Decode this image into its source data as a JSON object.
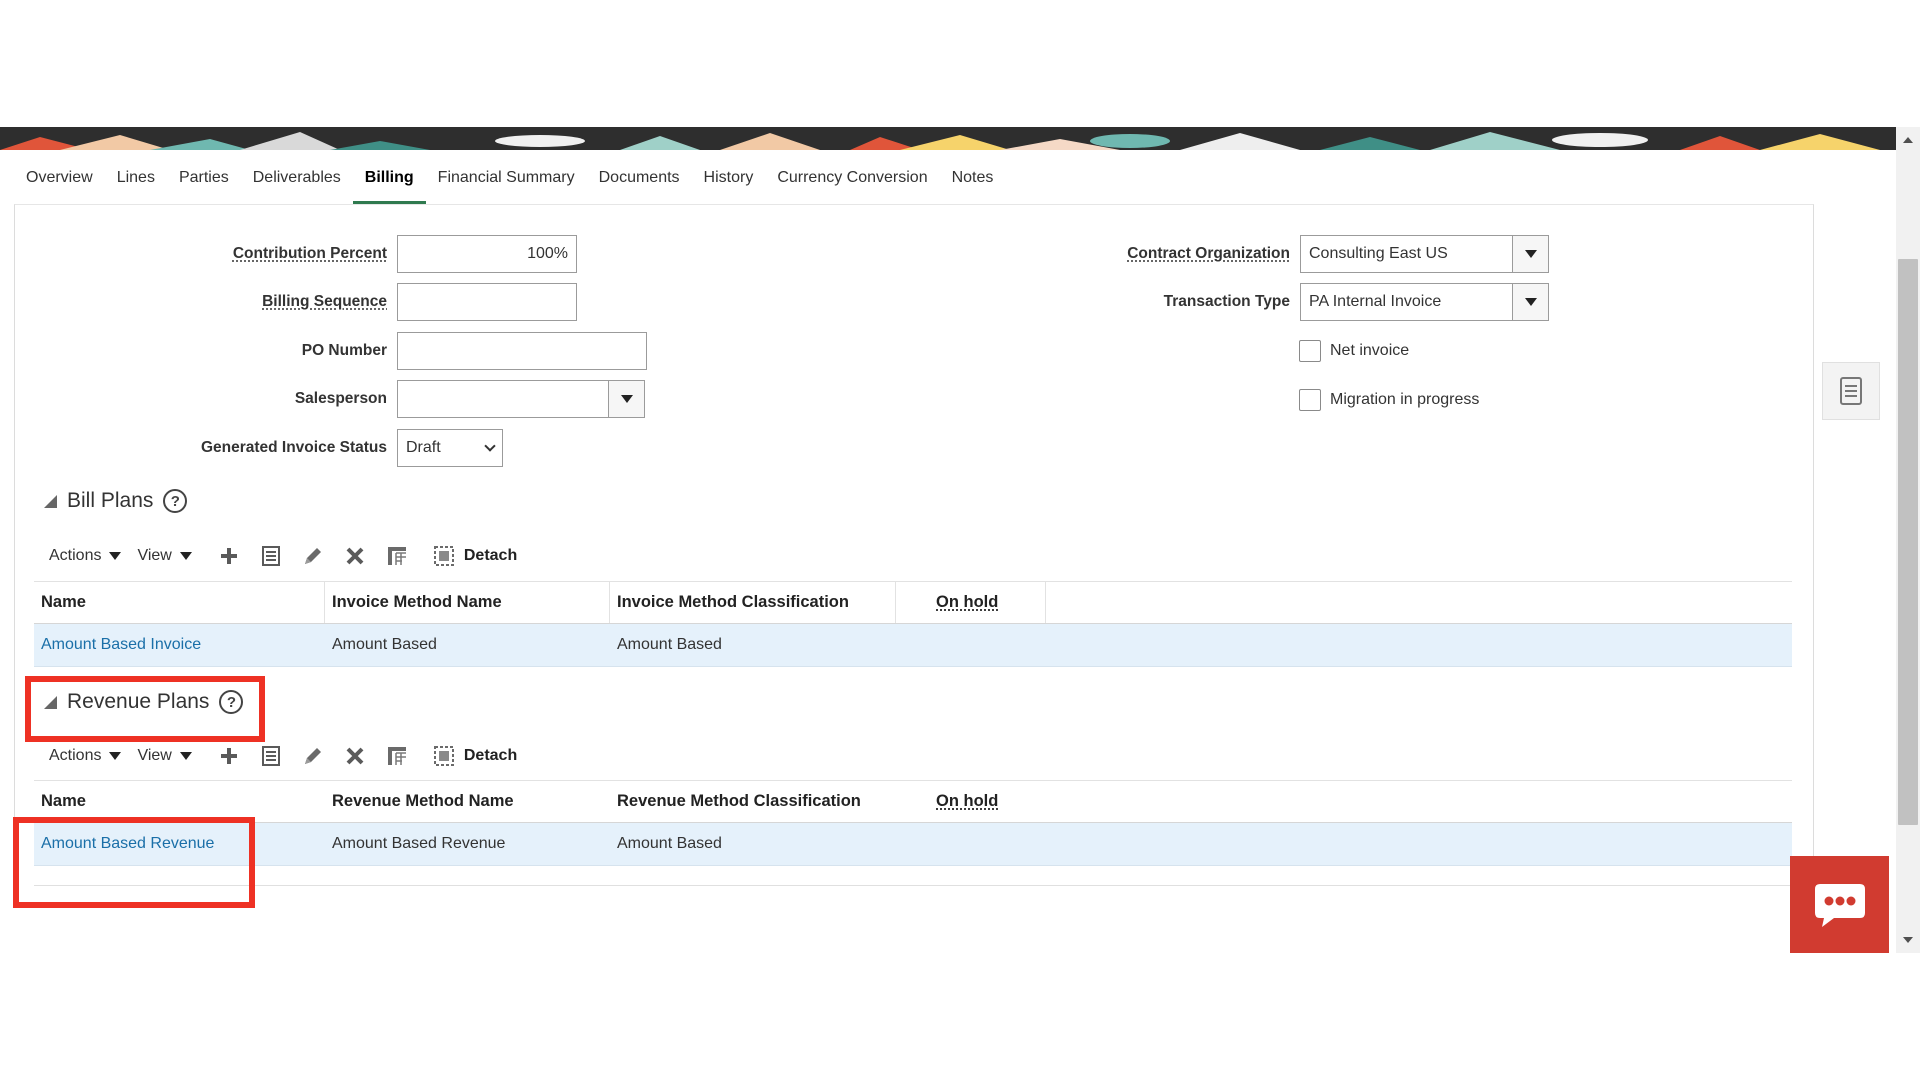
{
  "tabs": [
    "Overview",
    "Lines",
    "Parties",
    "Deliverables",
    "Billing",
    "Financial Summary",
    "Documents",
    "History",
    "Currency Conversion",
    "Notes"
  ],
  "active_tab": "Billing",
  "form": {
    "contribution_percent": {
      "label": "Contribution Percent",
      "value": "100%"
    },
    "billing_sequence": {
      "label": "Billing Sequence",
      "value": ""
    },
    "po_number": {
      "label": "PO Number",
      "value": ""
    },
    "salesperson": {
      "label": "Salesperson",
      "value": ""
    },
    "generated_invoice_status": {
      "label": "Generated Invoice Status",
      "value": "Draft"
    },
    "contract_organization": {
      "label": "Contract Organization",
      "value": "Consulting East US"
    },
    "transaction_type": {
      "label": "Transaction Type",
      "value": "PA Internal Invoice"
    },
    "net_invoice": {
      "label": "Net invoice",
      "checked": false
    },
    "migration_in_progress": {
      "label": "Migration in progress",
      "checked": false
    }
  },
  "bill_plans": {
    "title": "Bill Plans",
    "help": "?",
    "toolbar": {
      "actions": "Actions",
      "view": "View",
      "detach": "Detach"
    },
    "columns": [
      "Name",
      "Invoice Method Name",
      "Invoice Method Classification",
      "On hold"
    ],
    "rows": [
      {
        "name": "Amount Based Invoice",
        "method_name": "Amount Based",
        "classification": "Amount Based",
        "on_hold": ""
      }
    ]
  },
  "revenue_plans": {
    "title": "Revenue Plans",
    "help": "?",
    "toolbar": {
      "actions": "Actions",
      "view": "View",
      "detach": "Detach"
    },
    "columns": [
      "Name",
      "Revenue Method Name",
      "Revenue Method Classification",
      "On hold"
    ],
    "rows": [
      {
        "name": "Amount Based Revenue",
        "method_name": "Amount Based Revenue",
        "classification": "Amount Based",
        "on_hold": ""
      }
    ]
  },
  "icons": {
    "add": "plus-icon",
    "details": "details-icon",
    "edit": "pencil-icon",
    "delete": "x-icon",
    "freeze": "freeze-columns-icon",
    "detach": "detach-icon",
    "side_panel": "document-icon",
    "chat": "chat-bubble-icon"
  },
  "colors": {
    "highlight": "#ee3124",
    "active_tab": "#2f7a4f",
    "link": "#1a6fa8",
    "row_selected": "#e5f1fb",
    "chat": "#d13b30"
  }
}
